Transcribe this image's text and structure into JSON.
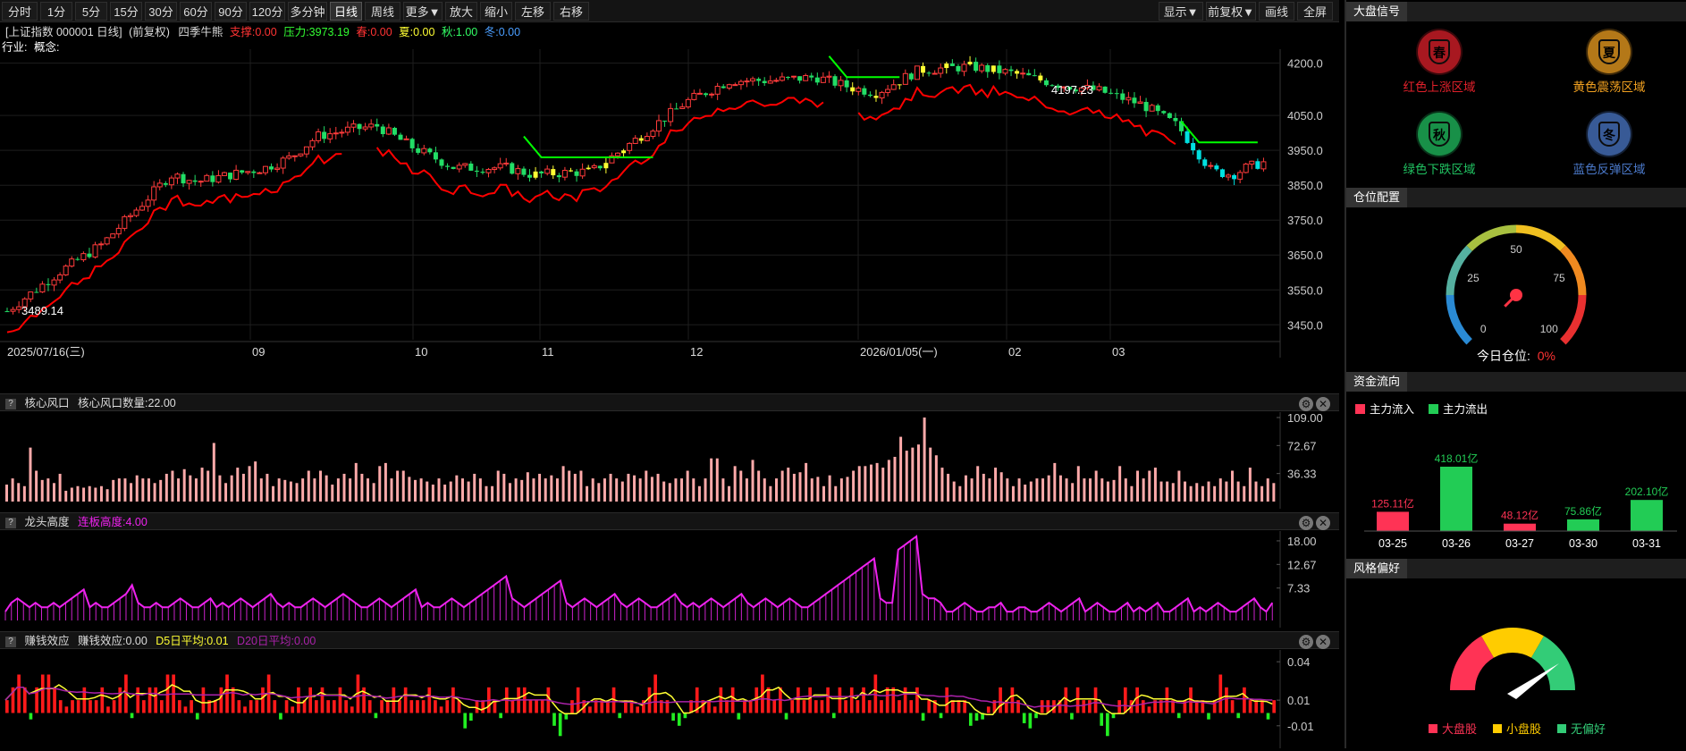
{
  "toolbar": {
    "left": [
      "分时",
      "1分",
      "5分",
      "15分",
      "30分",
      "60分",
      "90分",
      "120分",
      "多分钟",
      "日线",
      "周线",
      "更多▼",
      "放大",
      "缩小",
      "左移",
      "右移"
    ],
    "right": [
      "显示▼",
      "前复权▼",
      "画线",
      "全屏"
    ],
    "active": "日线"
  },
  "info": {
    "stock": "[上证指数 000001 日线]",
    "adjust": "(前复权)",
    "indicator": "四季牛熊",
    "support": "支撑:0.00",
    "pressure": "压力:3973.19",
    "spring": "春:0.00",
    "summer": "夏:0.00",
    "autumn": "秋:1.00",
    "winter": "冬:0.00",
    "industry": "行业:",
    "concept": "概念:"
  },
  "colors": {
    "up": "#ff3b3b",
    "down": "#22dd66",
    "yellow": "#ffff33",
    "cyan": "#00e0e0",
    "magenta": "#ee22ee",
    "support": "#ff0000",
    "pressure": "#00ff00"
  },
  "chart_data": [
    {
      "type": "candlestick",
      "yticks": [
        "4200.0",
        "4050.0",
        "3950.0",
        "3850.0",
        "3750.0",
        "3650.0",
        "3550.0",
        "3450.0"
      ],
      "ylim": [
        3420,
        4240
      ],
      "xlabels": [
        "2025/07/16(三)",
        "09",
        "10",
        "11",
        "12",
        "2026/01/05(一)",
        "02",
        "03"
      ],
      "annotations": {
        "high": "4197.23",
        "low": "3489.14"
      },
      "pressure_label": "3973.19"
    },
    {
      "type": "bar",
      "title": "核心风口",
      "value_label": "核心风口数量:22.00",
      "yticks": [
        "109.00",
        "72.67",
        "36.33"
      ],
      "values": [
        22,
        30,
        24,
        20,
        70,
        40,
        28,
        30,
        24,
        36,
        14,
        18,
        20,
        18,
        20,
        18,
        20,
        16,
        28,
        30,
        30,
        24,
        34,
        30,
        30,
        24,
        28,
        36,
        40,
        30,
        42,
        34,
        30,
        44,
        40,
        76,
        34,
        24,
        34,
        44,
        36,
        46,
        52,
        30,
        36,
        20,
        30,
        28,
        26,
        24,
        30,
        40,
        30,
        40,
        34,
        22,
        30,
        36,
        30,
        50,
        36,
        30,
        24,
        46,
        50,
        30,
        40,
        40,
        32,
        28,
        30,
        26,
        22,
        30,
        22,
        26,
        34,
        30,
        26,
        36,
        30,
        20,
        20,
        40,
        36,
        24,
        30,
        28,
        38,
        30,
        36,
        30,
        34,
        30,
        46,
        40,
        36,
        40,
        20,
        30,
        24,
        30,
        36,
        30,
        26,
        36,
        34,
        30,
        40,
        32,
        36,
        26,
        24,
        30,
        30,
        40,
        30,
        20,
        30,
        56,
        56,
        30,
        20,
        46,
        40,
        30,
        54,
        40,
        30,
        20,
        30,
        40,
        44,
        36,
        38,
        50,
        30,
        32,
        20,
        34,
        20,
        30,
        32,
        40,
        46,
        46,
        48,
        50,
        44,
        54,
        58,
        84,
        66,
        70,
        74,
        109,
        70,
        60,
        44,
        36,
        26,
        20,
        34,
        30,
        46,
        36,
        30,
        44,
        38,
        30,
        20,
        30,
        22,
        26,
        30,
        30,
        34,
        50,
        34,
        30,
        24,
        46,
        30,
        30,
        40,
        30,
        26,
        28,
        46,
        30,
        20,
        40,
        30,
        40,
        44,
        26,
        26,
        24,
        40,
        26,
        20,
        24,
        20,
        26,
        20,
        30,
        26,
        40,
        26,
        20,
        44,
        26,
        20,
        30,
        24
      ]
    },
    {
      "type": "line",
      "title": "龙头高度",
      "value_label": "连板高度:4.00",
      "yticks": [
        "18.00",
        "12.67",
        "7.33"
      ],
      "values": [
        2,
        4,
        5,
        4,
        3,
        4,
        3,
        3,
        4,
        3,
        4,
        5,
        6,
        7,
        3,
        4,
        3,
        3,
        4,
        5,
        6,
        8,
        4,
        3,
        3,
        4,
        3,
        3,
        4,
        5,
        4,
        3,
        3,
        4,
        5,
        3,
        4,
        3,
        4,
        5,
        4,
        3,
        4,
        5,
        6,
        4,
        3,
        4,
        3,
        3,
        4,
        5,
        4,
        3,
        4,
        5,
        6,
        5,
        4,
        3,
        3,
        4,
        5,
        4,
        3,
        4,
        5,
        6,
        7,
        3,
        4,
        3,
        3,
        4,
        5,
        4,
        3,
        4,
        5,
        6,
        7,
        8,
        9,
        10,
        5,
        4,
        3,
        4,
        5,
        6,
        7,
        8,
        9,
        4,
        3,
        4,
        5,
        4,
        3,
        4,
        5,
        6,
        4,
        3,
        4,
        5,
        4,
        3,
        3,
        4,
        5,
        6,
        4,
        3,
        4,
        3,
        4,
        5,
        4,
        3,
        4,
        5,
        6,
        4,
        3,
        4,
        5,
        4,
        3,
        4,
        5,
        4,
        3,
        3,
        4,
        5,
        6,
        7,
        8,
        9,
        10,
        11,
        12,
        13,
        14,
        5,
        4,
        4,
        16,
        17,
        18,
        19,
        6,
        5,
        5,
        4,
        2,
        2,
        3,
        4,
        3,
        2,
        2,
        3,
        3,
        4,
        2,
        2,
        3,
        3,
        2,
        2,
        3,
        4,
        3,
        2,
        3,
        4,
        5,
        2,
        3,
        4,
        3,
        2,
        2,
        3,
        4,
        2,
        3,
        2,
        3,
        4,
        2,
        2,
        3,
        4,
        5,
        2,
        3,
        2,
        3,
        4,
        3,
        2,
        2,
        3,
        4,
        5,
        3,
        2,
        4
      ]
    },
    {
      "type": "bar",
      "title": "赚钱效应",
      "value_label": "赚钱效应:0.00",
      "d5_label": "D5日平均:0.01",
      "d20_label": "D20日平均:0.00",
      "yticks": [
        "0.04",
        "0.01",
        "-0.01"
      ],
      "values": [
        0.01,
        0.02,
        0.03,
        0.02,
        -0.005,
        0.02,
        0.03,
        0.03,
        0.02,
        0.01,
        0.005,
        0.01,
        0.01,
        0.02,
        0.01,
        0.01,
        0.02,
        0.005,
        0.01,
        0.02,
        0.03,
        -0.004,
        0.02,
        0.01,
        0.02,
        0.02,
        0.01,
        0.03,
        0.03,
        0.01,
        0.005,
        0.01,
        -0.005,
        0.02,
        0.01,
        0.01,
        0.02,
        0.03,
        0.02,
        0.01,
        0.005,
        0.01,
        0.01,
        0.02,
        0.03,
        0.01,
        -0.005,
        0.01,
        0.005,
        0.02,
        0.01,
        0.02,
        0.01,
        0.02,
        0.01,
        0.01,
        0.02,
        0.01,
        0.005,
        0.03,
        0.02,
        0.01,
        -0.004,
        0.01,
        0.01,
        0.02,
        0.01,
        0.02,
        0.01,
        0.01,
        0.01,
        0.02,
        0.01,
        0.005,
        0.01,
        0.02,
        0.01,
        -0.012,
        -0.006,
        0.01,
        0.01,
        0.02,
        0.01,
        -0.004,
        0.02,
        0.01,
        0.02,
        0.02,
        0.01,
        0.01,
        0.01,
        0.02,
        -0.01,
        -0.018,
        -0.005,
        0.01,
        0.02,
        0.01,
        0.005,
        0.01,
        0.01,
        0.01,
        0.02,
        -0.004,
        0.01,
        0.01,
        0.005,
        0.01,
        0.02,
        0.03,
        0.01,
        0.01,
        -0.006,
        -0.01,
        -0.004,
        0.01,
        0.02,
        0.01,
        0.01,
        0.005,
        0.02,
        0.01,
        0.02,
        -0.005,
        0.01,
        0.01,
        0.02,
        0.03,
        0.02,
        0.01,
        0.02,
        -0.005,
        0.01,
        0.02,
        0.01,
        0.02,
        0.01,
        0.01,
        0.02,
        -0.004,
        0.02,
        0.01,
        0.02,
        0.01,
        0.02,
        0.01,
        0.03,
        0.01,
        0.02,
        0.02,
        0.01,
        0.02,
        0.01,
        0.02,
        -0.006,
        0.01,
        0.01,
        -0.004,
        0.02,
        0.01,
        0.01,
        0.01,
        -0.01,
        -0.006,
        -0.005,
        0.005,
        0.01,
        0.02,
        0.01,
        0.02,
        0.01,
        -0.008,
        -0.012,
        -0.004,
        0.01,
        0.01,
        0.01,
        0.01,
        0.02,
        -0.005,
        0.02,
        0.01,
        0.01,
        0.02,
        -0.01,
        -0.018,
        -0.004,
        0.01,
        0.02,
        0.01,
        0.02,
        0.01,
        0.005,
        0.01,
        0.01,
        0.02,
        0.01,
        -0.004,
        0.01,
        0.02,
        0.01,
        0.01,
        -0.005,
        0.01,
        0.03,
        0.02,
        0.01,
        -0.004,
        0.02,
        0.01,
        0.01,
        0.01,
        -0.005,
        0.01
      ]
    },
    {
      "type": "bar",
      "title": "资金流向",
      "categories": [
        "03-25",
        "03-26",
        "03-27",
        "03-30",
        "03-31"
      ],
      "values": [
        125.11,
        418.01,
        48.12,
        75.86,
        202.1
      ],
      "labels": [
        "125.11亿",
        "418.01亿",
        "48.12亿",
        "75.86亿",
        "202.10亿"
      ],
      "direction": [
        "in",
        "out",
        "in",
        "out",
        "out"
      ],
      "legend": [
        "主力流入",
        "主力流出"
      ]
    }
  ],
  "panels": {
    "p1": {
      "title": "核心风口",
      "label": "核心风口数量:22.00"
    },
    "p2": {
      "title": "龙头高度",
      "label": "连板高度:4.00"
    },
    "p3": {
      "title": "赚钱效应",
      "label": "赚钱效应:0.00",
      "d5": "D5日平均:0.01",
      "d20": "D20日平均:0.00"
    }
  },
  "right": {
    "signal": {
      "title": "大盘信号",
      "items": [
        {
          "char": "春",
          "label": "红色上涨区域",
          "color": "#e0202a"
        },
        {
          "char": "夏",
          "label": "黄色震荡区域",
          "color": "#f0a020"
        },
        {
          "char": "秋",
          "label": "绿色下跌区域",
          "color": "#20c060"
        },
        {
          "char": "冬",
          "label": "蓝色反弹区域",
          "color": "#4a78c8"
        }
      ]
    },
    "position": {
      "title": "仓位配置",
      "ticks": [
        "0",
        "25",
        "50",
        "75",
        "100"
      ],
      "today_label": "今日仓位:",
      "today_value": "0%",
      "level": 0
    },
    "flow": {
      "title": "资金流向"
    },
    "style": {
      "title": "风格偏好",
      "legend": [
        "大盘股",
        "小盘股",
        "无偏好"
      ],
      "colors": [
        "#ff3355",
        "#ffcc00",
        "#33cc77"
      ]
    }
  }
}
